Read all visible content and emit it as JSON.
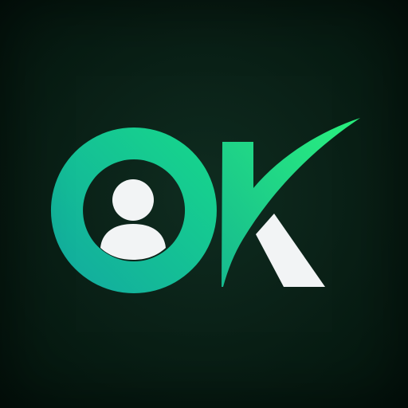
{
  "app_icon": {
    "icon_name": "ok-user-check-logo",
    "letters": [
      "O",
      "K"
    ],
    "colors": {
      "background": "#061a11",
      "ring_gradient_start": "#12a8a0",
      "ring_gradient_end": "#17d98a",
      "check_gradient_start": "#16b98f",
      "check_gradient_end": "#2af27e",
      "user_silhouette": "#f2f4f5",
      "k_leg": "#f2f4f5"
    }
  }
}
